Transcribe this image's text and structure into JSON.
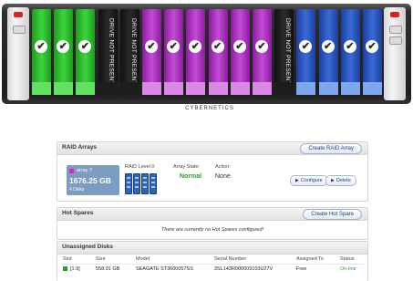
{
  "chassis": {
    "brand": "CYBERNETICS",
    "bays": [
      {
        "color": "green",
        "text": ""
      },
      {
        "color": "green",
        "text": ""
      },
      {
        "color": "green",
        "text": ""
      },
      {
        "color": "empty",
        "text": "DRIVE NOT PRESENT"
      },
      {
        "color": "empty",
        "text": "DRIVE NOT PRESENT"
      },
      {
        "color": "purple",
        "text": ""
      },
      {
        "color": "purple",
        "text": ""
      },
      {
        "color": "purple",
        "text": ""
      },
      {
        "color": "purple",
        "text": ""
      },
      {
        "color": "purple",
        "text": ""
      },
      {
        "color": "purple",
        "text": ""
      },
      {
        "color": "empty",
        "text": "DRIVE NOT PRESENT"
      },
      {
        "color": "blue",
        "text": ""
      },
      {
        "color": "blue",
        "text": ""
      },
      {
        "color": "blue",
        "text": ""
      },
      {
        "color": "blue",
        "text": ""
      }
    ],
    "colors": {
      "green": "#3bd53b",
      "purple": "#c24cd6",
      "blue": "#3b6ad6",
      "empty": "#1a1a1a",
      "left_light": "#e02020"
    }
  },
  "raid": {
    "title": "RAID Arrays",
    "create_button": "Create RAID Array",
    "array": {
      "name": "array 7",
      "size": "1676.25 GB",
      "disks": "4 Disks",
      "raid_level": "RAID Level 0",
      "state_label": "Array State:",
      "state_value": "Normal",
      "action_label": "Action:",
      "action_value": "None",
      "configure_button": "Configure",
      "delete_button": "Delete"
    }
  },
  "hot_spares": {
    "title": "Hot Spares",
    "create_button": "Create Hot Spare",
    "message": "There are currently no Hot Spares configured!"
  },
  "unassigned": {
    "title": "Unassigned Disks",
    "columns": [
      "Slot",
      "Size",
      "Model",
      "Serial Number",
      "Assigned To",
      "Status"
    ],
    "rows": [
      {
        "slot": "[1:9]",
        "size": "558.91 GB",
        "model": "SEAGATE ST3600057SS",
        "serial": "3SL143R000009103U27V",
        "assigned": "Free",
        "status": "On-line"
      }
    ]
  }
}
